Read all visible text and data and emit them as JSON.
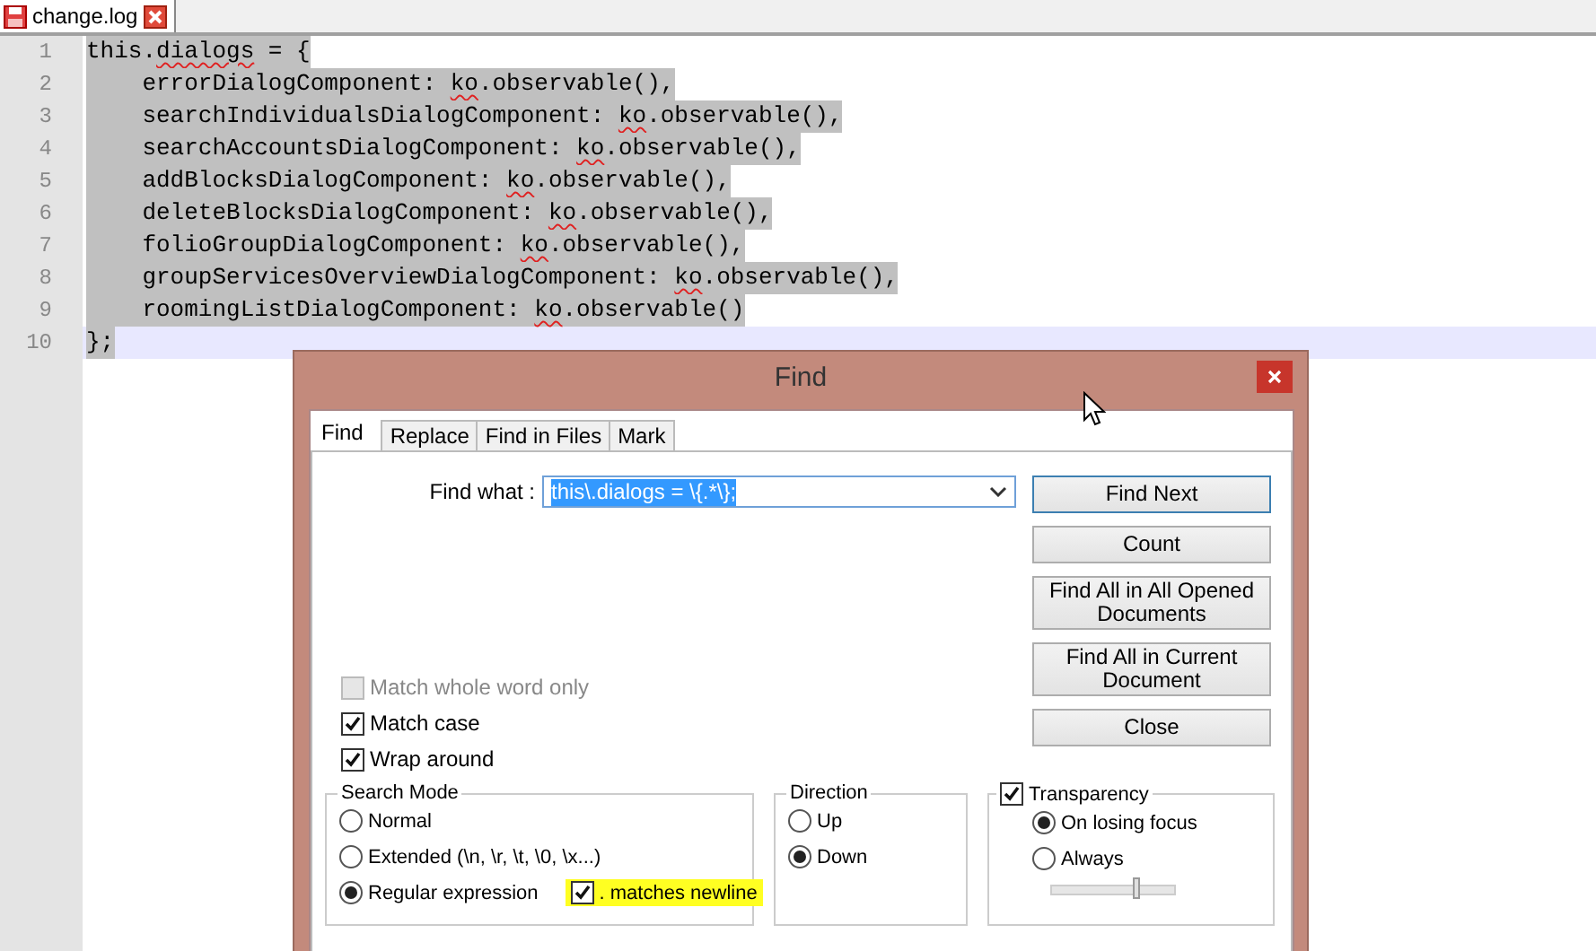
{
  "file_tab": {
    "title": "change.log"
  },
  "editor": {
    "lines": [
      {
        "number": "1",
        "selected": true,
        "current": false,
        "segments": [
          {
            "text": "this.",
            "misspelled": false
          },
          {
            "text": "dialogs",
            "misspelled": true
          },
          {
            "text": " = {",
            "misspelled": false
          }
        ]
      },
      {
        "number": "2",
        "selected": true,
        "current": false,
        "segments": [
          {
            "text": "    errorDialogComponent: ",
            "misspelled": false
          },
          {
            "text": "ko",
            "misspelled": true
          },
          {
            "text": ".observable(),",
            "misspelled": false
          }
        ]
      },
      {
        "number": "3",
        "selected": true,
        "current": false,
        "segments": [
          {
            "text": "    searchIndividualsDialogComponent: ",
            "misspelled": false
          },
          {
            "text": "ko",
            "misspelled": true
          },
          {
            "text": ".observable(),",
            "misspelled": false
          }
        ]
      },
      {
        "number": "4",
        "selected": true,
        "current": false,
        "segments": [
          {
            "text": "    searchAccountsDialogComponent: ",
            "misspelled": false
          },
          {
            "text": "ko",
            "misspelled": true
          },
          {
            "text": ".observable(),",
            "misspelled": false
          }
        ]
      },
      {
        "number": "5",
        "selected": true,
        "current": false,
        "segments": [
          {
            "text": "    addBlocksDialogComponent: ",
            "misspelled": false
          },
          {
            "text": "ko",
            "misspelled": true
          },
          {
            "text": ".observable(),",
            "misspelled": false
          }
        ]
      },
      {
        "number": "6",
        "selected": true,
        "current": false,
        "segments": [
          {
            "text": "    deleteBlocksDialogComponent: ",
            "misspelled": false
          },
          {
            "text": "ko",
            "misspelled": true
          },
          {
            "text": ".observable(),",
            "misspelled": false
          }
        ]
      },
      {
        "number": "7",
        "selected": true,
        "current": false,
        "segments": [
          {
            "text": "    folioGroupDialogComponent: ",
            "misspelled": false
          },
          {
            "text": "ko",
            "misspelled": true
          },
          {
            "text": ".observable(),",
            "misspelled": false
          }
        ]
      },
      {
        "number": "8",
        "selected": true,
        "current": false,
        "segments": [
          {
            "text": "    groupServicesOverviewDialogComponent: ",
            "misspelled": false
          },
          {
            "text": "ko",
            "misspelled": true
          },
          {
            "text": ".observable(),",
            "misspelled": false
          }
        ]
      },
      {
        "number": "9",
        "selected": true,
        "current": false,
        "segments": [
          {
            "text": "    roomingListDialogComponent: ",
            "misspelled": false
          },
          {
            "text": "ko",
            "misspelled": true
          },
          {
            "text": ".observable()",
            "misspelled": false
          }
        ]
      },
      {
        "number": "10",
        "selected": true,
        "current": true,
        "segments": [
          {
            "text": "};",
            "misspelled": false
          }
        ]
      }
    ]
  },
  "find_dialog": {
    "title": "Find",
    "tabs": [
      {
        "label": "Find",
        "selected": true
      },
      {
        "label": "Replace",
        "selected": false
      },
      {
        "label": "Find in Files",
        "selected": false
      },
      {
        "label": "Mark",
        "selected": false
      }
    ],
    "find_what": {
      "label": "Find what :",
      "value": "this\\.dialogs = \\{.*\\};"
    },
    "buttons": [
      {
        "label": "Find Next",
        "default": true
      },
      {
        "label": "Count",
        "default": false
      },
      {
        "label": "Find All in All Opened Documents",
        "default": false
      },
      {
        "label": "Find All in Current Document",
        "default": false
      },
      {
        "label": "Close",
        "default": false
      }
    ],
    "options": [
      {
        "label": "Match whole word only",
        "checked": false,
        "disabled": true
      },
      {
        "label": "Match case",
        "checked": true,
        "disabled": false
      },
      {
        "label": "Wrap around",
        "checked": true,
        "disabled": false
      }
    ],
    "search_mode": {
      "title": "Search Mode",
      "options": [
        {
          "label": "Normal",
          "selected": false
        },
        {
          "label": "Extended (\\n, \\r, \\t, \\0, \\x...)",
          "selected": false
        },
        {
          "label": "Regular expression",
          "selected": true
        }
      ],
      "dot_matches_newline": {
        "label": ". matches newline",
        "checked": true,
        "highlighted": true
      }
    },
    "direction": {
      "title": "Direction",
      "options": [
        {
          "label": "Up",
          "selected": false
        },
        {
          "label": "Down",
          "selected": true
        }
      ]
    },
    "transparency": {
      "label": "Transparency",
      "checked": true,
      "options": [
        {
          "label": "On losing focus",
          "selected": true
        },
        {
          "label": "Always",
          "selected": false
        }
      ],
      "level": 0.69
    }
  }
}
